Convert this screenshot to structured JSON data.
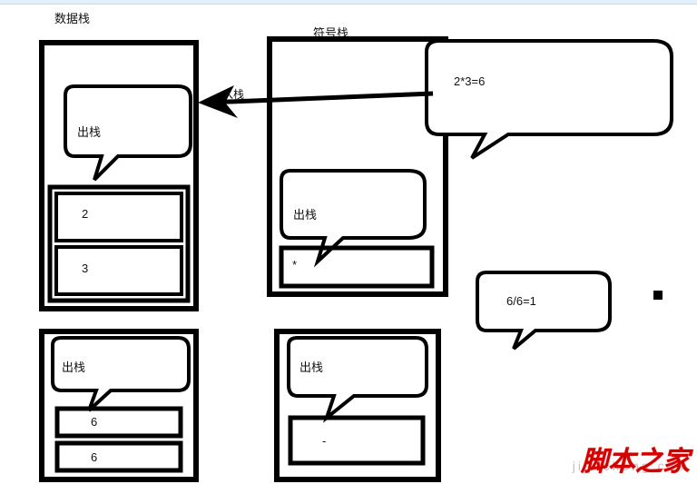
{
  "titles": {
    "data_stack": "数据栈",
    "symbol_stack": "符号栈"
  },
  "labels": {
    "push": "入栈",
    "pop1": "出栈",
    "pop2": "出栈",
    "pop3": "出栈",
    "pop4": "出栈"
  },
  "math": {
    "mult": "2*3=6",
    "div": "6/6=1"
  },
  "stack_values": {
    "data_top": "2",
    "data_bottom": "3",
    "sym_top": "*",
    "data2_top": "6",
    "data2_bottom": "6",
    "sym2_top": "-"
  },
  "watermark": {
    "red": "脚本之家",
    "url": "jiaocheng.com"
  }
}
